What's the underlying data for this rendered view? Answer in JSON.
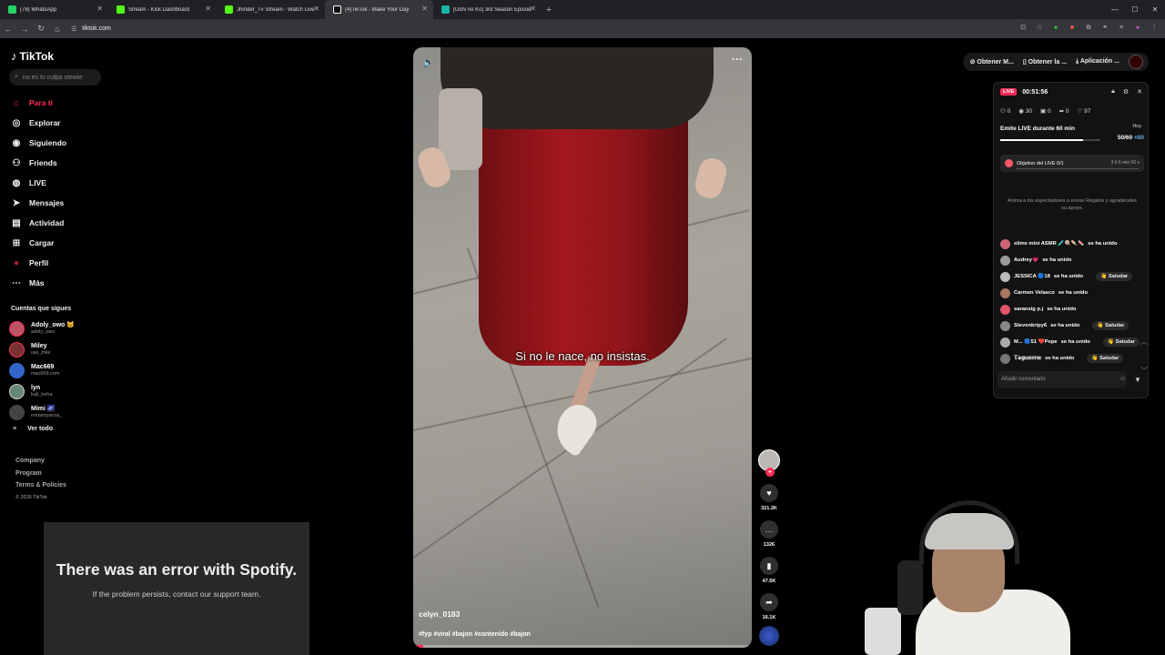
{
  "browser": {
    "tabs": [
      {
        "title": "(78) WhatsApp",
        "color": "#25d366"
      },
      {
        "title": "Stream - Kick Dashboard",
        "color": "#53fc18"
      },
      {
        "title": "Jhinder_Tv Stream - Watch Live",
        "color": "#53fc18"
      },
      {
        "title": "(4)TikTok - Make Your Day",
        "color": "#ffffff"
      },
      {
        "title": "[Oshi no Ko] 3rd Season Episode",
        "color": "#1ab3a6"
      }
    ],
    "url": "tiktok.com"
  },
  "sidebar": {
    "logo": "TikTok",
    "search_placeholder": "no es tu culpa stewie",
    "nav": [
      {
        "label": "Para ti",
        "icon": "home-icon"
      },
      {
        "label": "Explorar",
        "icon": "compass-icon"
      },
      {
        "label": "Siguiendo",
        "icon": "following-icon"
      },
      {
        "label": "Friends",
        "icon": "friends-icon"
      },
      {
        "label": "LIVE",
        "icon": "live-icon"
      },
      {
        "label": "Mensajes",
        "icon": "messages-icon"
      },
      {
        "label": "Actividad",
        "icon": "activity-icon"
      },
      {
        "label": "Cargar",
        "icon": "upload-icon"
      },
      {
        "label": "Perfil",
        "icon": "profile-icon"
      },
      {
        "label": "Más",
        "icon": "more-icon"
      }
    ],
    "following_title": "Cuentas que sigues",
    "accounts": [
      {
        "name": "Adoly_owo 🐱",
        "handle": "adoly_owo"
      },
      {
        "name": "Miley",
        "handle": "uwi_mile"
      },
      {
        "name": "Mac669",
        "handle": "mac669.com"
      },
      {
        "name": "lyn",
        "handle": "kali_heha"
      },
      {
        "name": "Mimi 🌌",
        "handle": "miriamyanza_"
      }
    ],
    "see_all": "Ver todo",
    "footer": [
      "Company",
      "Program",
      "Terms & Policies"
    ],
    "copyright": "© 2026 TikTok"
  },
  "spotify": {
    "heading": "There was an error with Spotify.",
    "message": "If the problem persists, contact our support team."
  },
  "video": {
    "caption": "Si no le nace, no insistas.",
    "author": "celyn_0183",
    "hashtags": "#fyp #viral #bajon #contenido #bajon",
    "progress": 0.03
  },
  "actions": {
    "likes": "321.2K",
    "comments": "1326",
    "saves": "47.5K",
    "shares": "16.1K"
  },
  "topbar": {
    "btn1": "Obtener M...",
    "btn2": "Obtener la ...",
    "btn3": "Aplicación ..."
  },
  "live": {
    "badge": "LIVE",
    "timer": "00:51:56",
    "stats": {
      "a": "0",
      "viewers": "30",
      "gifts": "0",
      "shares": "0",
      "likes": "97"
    },
    "goal_title": "Emite LIVE durante 60 min",
    "goal_progress": "50/60",
    "goal_fraction": 0.83,
    "today": "Hoy",
    "coins": "×80",
    "objective": "Objetivo del LIVE 0/1",
    "objective_time": "3 h 6 min 50 s",
    "prompt": "Anima a los espectadores a enviar Regalos y agradéceles su apoyo.",
    "joins": [
      {
        "name": "slime mini ASMR 🧪🍭🍡🍬",
        "status": "se ha unido",
        "greet": ""
      },
      {
        "name": "Audrey💗",
        "status": "se ha unido",
        "greet": ""
      },
      {
        "name": "JESSICA 🔵18",
        "status": "se ha unido",
        "greet": "👋 Saludar"
      },
      {
        "name": "Carmen Velasco",
        "status": "se ha unido",
        "greet": ""
      },
      {
        "name": "saransig p.j",
        "status": "se ha unido",
        "greet": ""
      },
      {
        "name": "Stevenkripy6",
        "status": "se ha unido",
        "greet": "👋 Saludar"
      },
      {
        "name": "M... 🔵51 ❤️Pepe",
        "status": "se ha unido",
        "greet": "👋 Saludar"
      },
      {
        "name": "𝕋𝕒𝕘𝕦𝕖𝕞𝕖",
        "status": "se ha unido",
        "greet": "👋 Saludar"
      }
    ],
    "comment_placeholder": "Añadir comentario"
  },
  "colors": {
    "accent": "#fe2c55"
  }
}
